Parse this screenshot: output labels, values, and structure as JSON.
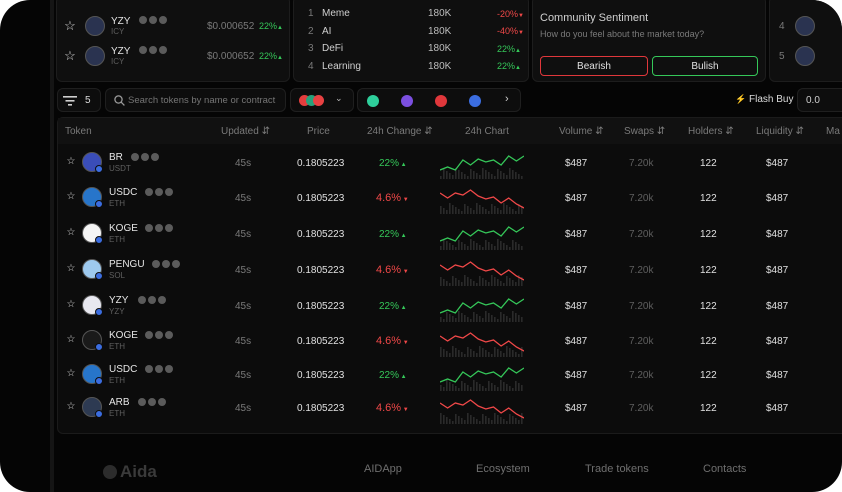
{
  "mini_left": [
    {
      "symbol": "YZY",
      "chain": "ICY",
      "price": "$0.000652",
      "change": "22%",
      "dir": "up"
    },
    {
      "symbol": "YZY",
      "chain": "ICY",
      "price": "$0.000652",
      "change": "22%",
      "dir": "up"
    }
  ],
  "trending": [
    {
      "rank": "1",
      "name": "Meme",
      "vol": "180K",
      "change": "-20%",
      "dir": "down"
    },
    {
      "rank": "2",
      "name": "AI",
      "vol": "180K",
      "change": "-40%",
      "dir": "down"
    },
    {
      "rank": "3",
      "name": "DeFi",
      "vol": "180K",
      "change": "22%",
      "dir": "up"
    },
    {
      "rank": "4",
      "name": "Learning",
      "vol": "180K",
      "change": "22%",
      "dir": "up"
    }
  ],
  "sentiment": {
    "title": "Community Sentiment",
    "question": "How do you feel about the market today?",
    "bearish": "Bearish",
    "bullish": "Bulish"
  },
  "mini_right": [
    {
      "rank": "4"
    },
    {
      "rank": "5"
    }
  ],
  "toolbar": {
    "filter_count": "5",
    "search_placeholder": "Search tokens by name or contract",
    "flash_buy": "Flash Buy",
    "amount": "0.0"
  },
  "headers": {
    "token": "Token",
    "updated": "Updated",
    "price": "Price",
    "change": "24h Change",
    "chart": "24h Chart",
    "volume": "Volume",
    "swaps": "Swaps",
    "holders": "Holders",
    "liquidity": "Liquidity",
    "mc": "Ma"
  },
  "tokens": [
    {
      "symbol": "BR",
      "chain": "USDT",
      "updated": "45s",
      "price": "0.1805223",
      "change": "22%",
      "dir": "up",
      "volume": "$487",
      "swaps": "7.20k",
      "holders": "122",
      "liquidity": "$487",
      "color": "#3a4db8"
    },
    {
      "symbol": "USDC",
      "chain": "ETH",
      "updated": "45s",
      "price": "0.1805223",
      "change": "4.6%",
      "dir": "down",
      "volume": "$487",
      "swaps": "7.20k",
      "holders": "122",
      "liquidity": "$487",
      "color": "#2775ca"
    },
    {
      "symbol": "KOGE",
      "chain": "ETH",
      "updated": "45s",
      "price": "0.1805223",
      "change": "22%",
      "dir": "up",
      "volume": "$487",
      "swaps": "7.20k",
      "holders": "122",
      "liquidity": "$487",
      "color": "#f5f5f5"
    },
    {
      "symbol": "PENGU",
      "chain": "SOL",
      "updated": "45s",
      "price": "0.1805223",
      "change": "4.6%",
      "dir": "down",
      "volume": "$487",
      "swaps": "7.20k",
      "holders": "122",
      "liquidity": "$487",
      "color": "#9ec9ee"
    },
    {
      "symbol": "YZY",
      "chain": "YZY",
      "updated": "45s",
      "price": "0.1805223",
      "change": "22%",
      "dir": "up",
      "volume": "$487",
      "swaps": "7.20k",
      "holders": "122",
      "liquidity": "$487",
      "color": "#e8e8f0"
    },
    {
      "symbol": "KOGE",
      "chain": "ETH",
      "updated": "45s",
      "price": "0.1805223",
      "change": "4.6%",
      "dir": "down",
      "volume": "$487",
      "swaps": "7.20k",
      "holders": "122",
      "liquidity": "$487",
      "color": "#1a1a1a"
    },
    {
      "symbol": "USDC",
      "chain": "ETH",
      "updated": "45s",
      "price": "0.1805223",
      "change": "22%",
      "dir": "up",
      "volume": "$487",
      "swaps": "7.20k",
      "holders": "122",
      "liquidity": "$487",
      "color": "#2775ca"
    },
    {
      "symbol": "ARB",
      "chain": "ETH",
      "updated": "45s",
      "price": "0.1805223",
      "change": "4.6%",
      "dir": "down",
      "volume": "$487",
      "swaps": "7.20k",
      "holders": "122",
      "liquidity": "$487",
      "color": "#2d3a52"
    }
  ],
  "footer": {
    "brand": "Aida",
    "links": [
      "AIDApp",
      "Ecosystem",
      "Trade tokens",
      "Contacts"
    ]
  },
  "colors": {
    "up": "#35c759",
    "down": "#f04848",
    "bullish": "#35c759",
    "bearish": "#e0373b"
  }
}
